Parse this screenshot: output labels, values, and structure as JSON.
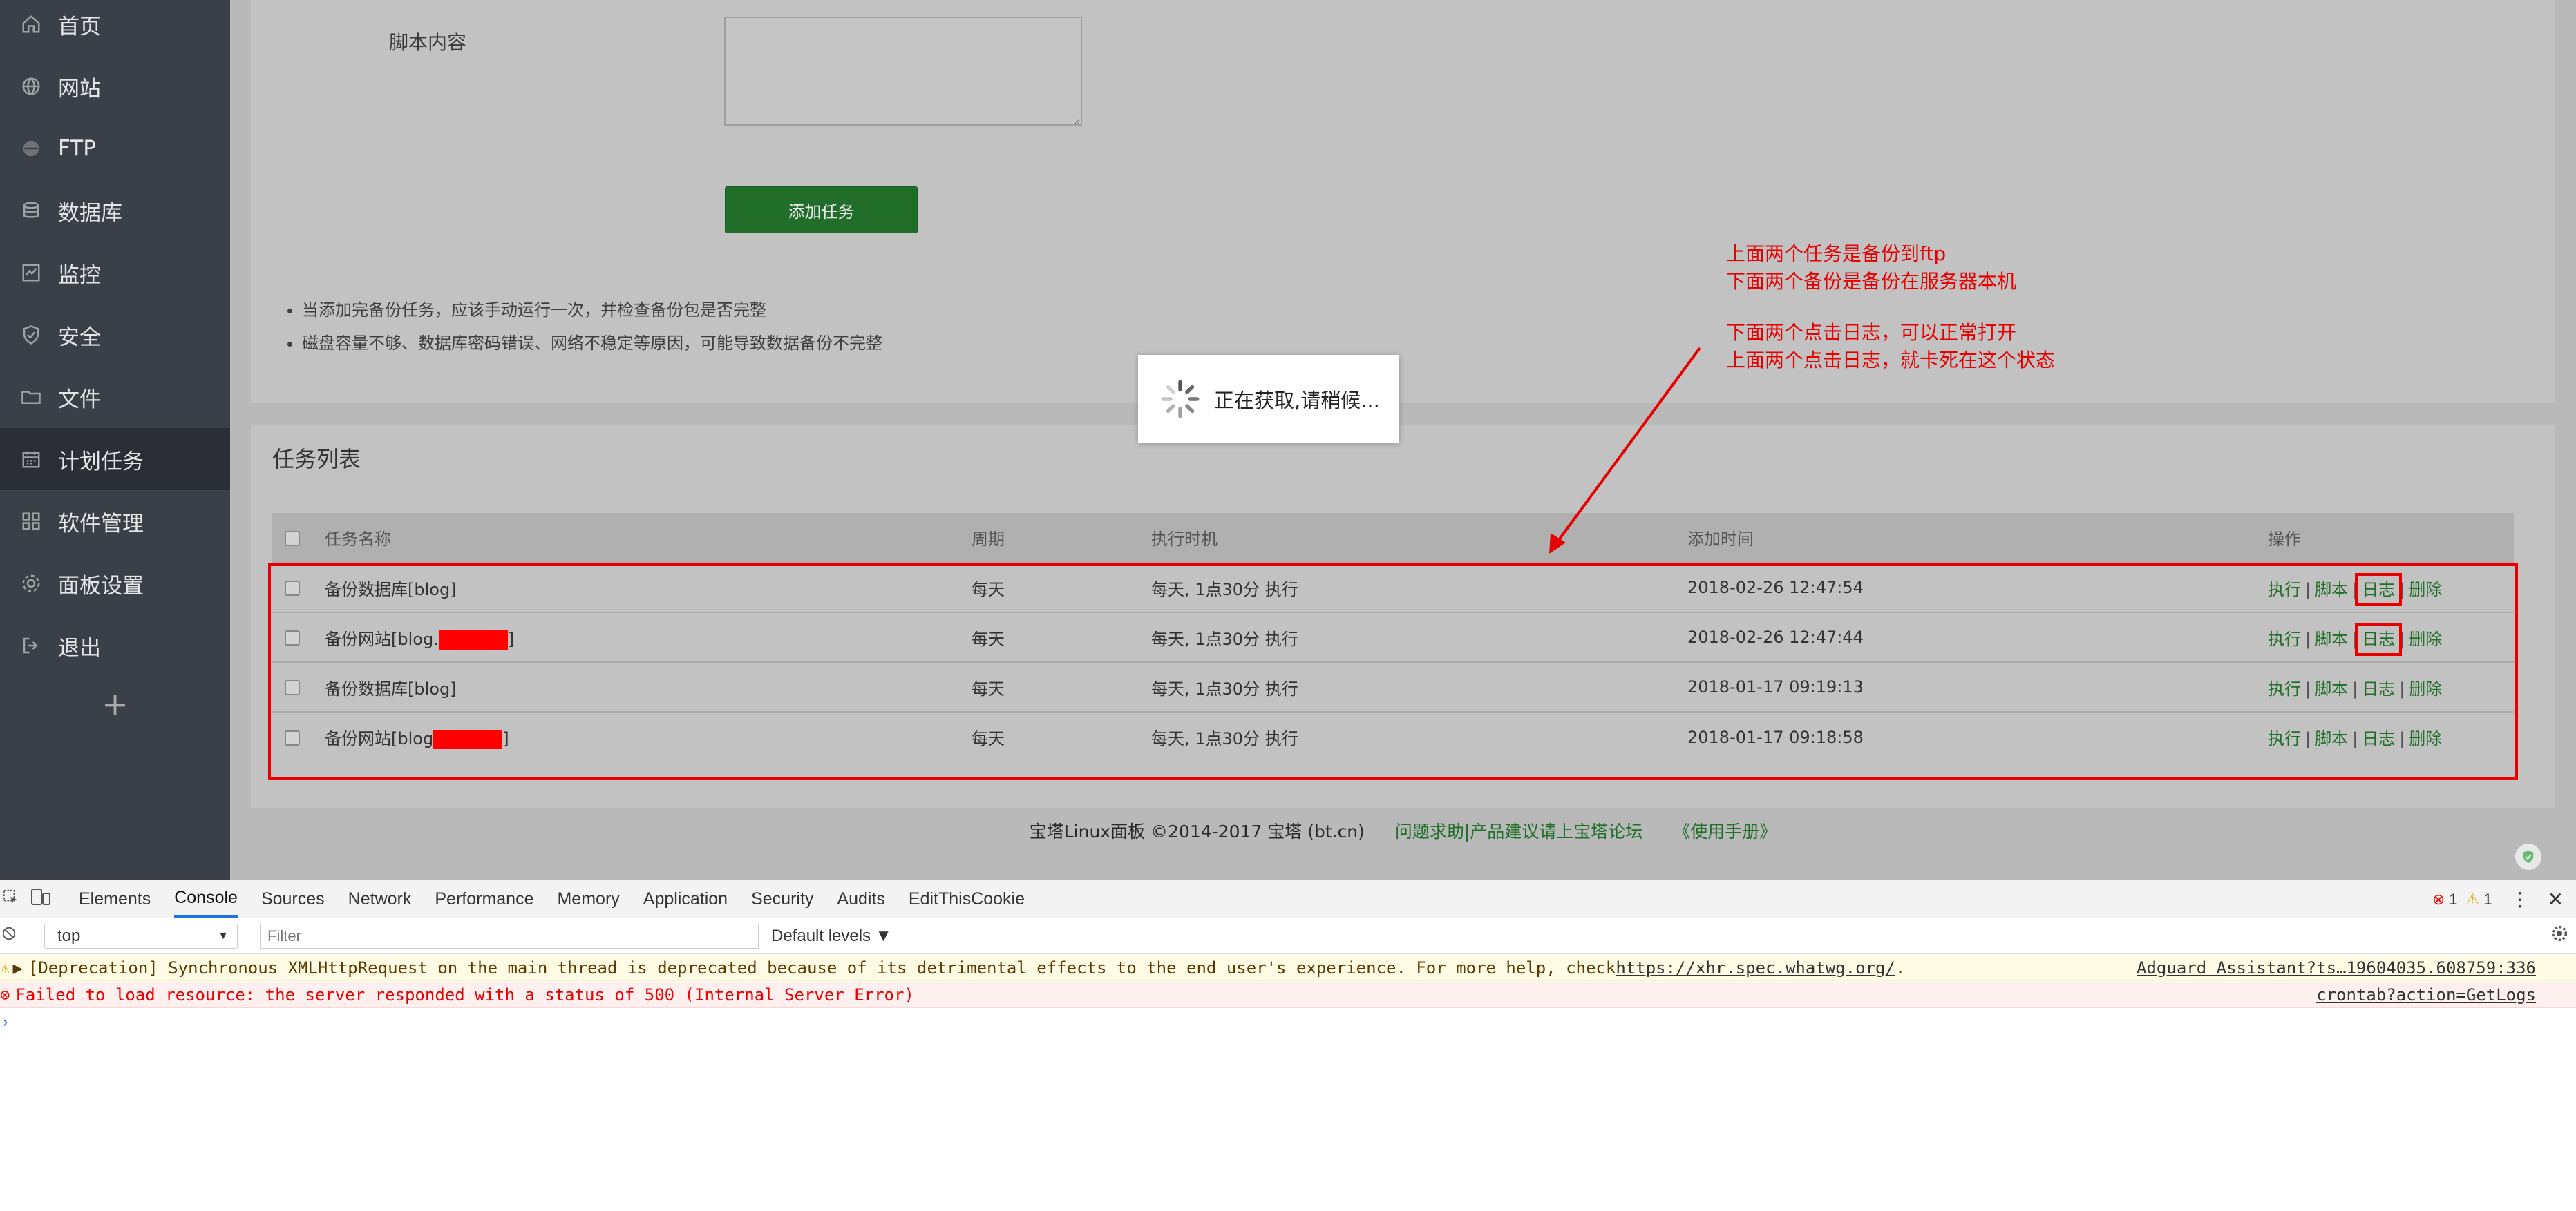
{
  "sidebar": {
    "items": [
      {
        "label": "首页",
        "icon": "home-icon"
      },
      {
        "label": "网站",
        "icon": "globe-icon"
      },
      {
        "label": "FTP",
        "icon": "ftp-icon"
      },
      {
        "label": "数据库",
        "icon": "database-icon"
      },
      {
        "label": "监控",
        "icon": "monitor-icon"
      },
      {
        "label": "安全",
        "icon": "shield-icon"
      },
      {
        "label": "文件",
        "icon": "folder-icon"
      },
      {
        "label": "计划任务",
        "icon": "calendar-icon",
        "active": true
      },
      {
        "label": "软件管理",
        "icon": "apps-icon"
      },
      {
        "label": "面板设置",
        "icon": "gear-icon"
      },
      {
        "label": "退出",
        "icon": "logout-icon"
      }
    ],
    "add_label": "+"
  },
  "form": {
    "script_label": "脚本内容",
    "script_value": "",
    "add_button": "添加任务",
    "tips": [
      "当添加完备份任务，应该手动运行一次，并检查备份包是否完整",
      "磁盘容量不够、数据库密码错误、网络不稳定等原因，可能导致数据备份不完整"
    ]
  },
  "annotation": {
    "line1": "上面两个任务是备份到ftp",
    "line2": "下面两个备份是备份在服务器本机",
    "line3": "下面两个点击日志，可以正常打开",
    "line4": "上面两个点击日志，就卡死在这个状态"
  },
  "loading": {
    "text": "正在获取,请稍候..."
  },
  "task_list": {
    "title": "任务列表",
    "columns": [
      "任务名称",
      "周期",
      "执行时机",
      "添加时间",
      "操作"
    ],
    "rows": [
      {
        "name": "备份数据库[blog]",
        "cycle": "每天",
        "timing": "每天, 1点30分 执行",
        "added": "2018-02-26 12:47:54"
      },
      {
        "name_prefix": "备份网站[blog.",
        "name_suffix": "]",
        "cycle": "每天",
        "timing": "每天, 1点30分 执行",
        "added": "2018-02-26 12:47:44"
      },
      {
        "name": "备份数据库[blog]",
        "cycle": "每天",
        "timing": "每天, 1点30分 执行",
        "added": "2018-01-17 09:19:13"
      },
      {
        "name_prefix": "备份网站[blog",
        "name_suffix": "]",
        "cycle": "每天",
        "timing": "每天, 1点30分 执行",
        "added": "2018-01-17 09:18:58"
      }
    ],
    "ops": {
      "run": "执行",
      "script": "脚本",
      "log": "日志",
      "delete": "删除",
      "sep": "|"
    }
  },
  "footer": {
    "copyright": "宝塔Linux面板 ©2014-2017 宝塔 (bt.cn)",
    "forum_link": "问题求助|产品建议请上宝塔论坛",
    "manual_link": "《使用手册》"
  },
  "devtools": {
    "tabs": [
      "Elements",
      "Console",
      "Sources",
      "Network",
      "Performance",
      "Memory",
      "Application",
      "Security",
      "Audits",
      "EditThisCookie"
    ],
    "active_tab": "Console",
    "error_count": "1",
    "warning_count": "1",
    "context": "top",
    "filter_placeholder": "Filter",
    "levels": "Default levels ▼",
    "messages": [
      {
        "level": "warning",
        "text": "[Deprecation] Synchronous XMLHttpRequest on the main thread is deprecated because of its detrimental effects to the end user's experience. For more help, check ",
        "link": "https://xhr.spec.whatwg.org/",
        "tail": ".",
        "source": "Adguard Assistant?ts…19604035.608759:336"
      },
      {
        "level": "error",
        "text": "Failed to load resource: the server responded with a status of 500 (Internal Server Error)",
        "source": "crontab?action=GetLogs"
      }
    ]
  },
  "colors": {
    "highlight": "#e60000",
    "accent_green": "#216e2a",
    "sidebar_bg": "#3b4048"
  }
}
